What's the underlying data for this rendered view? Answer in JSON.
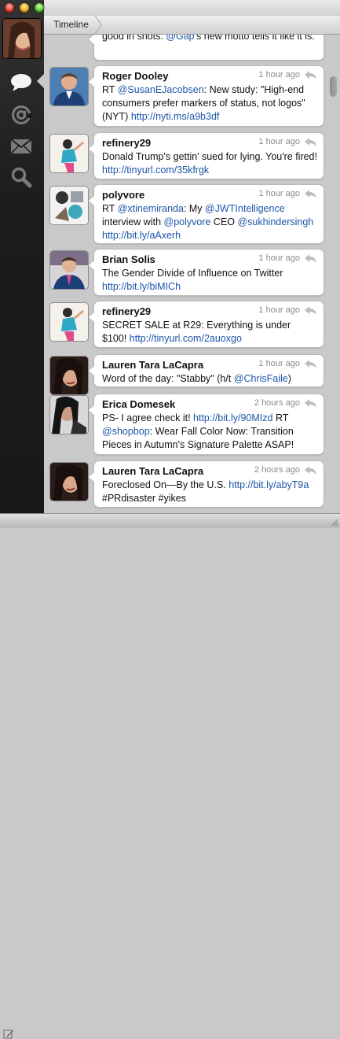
{
  "window": {
    "title": "Timeline"
  },
  "sidebar": {
    "items": [
      {
        "name": "timeline",
        "icon": "speech-bubble-icon"
      },
      {
        "name": "mentions",
        "icon": "at-sign-icon"
      },
      {
        "name": "messages",
        "icon": "envelope-icon"
      },
      {
        "name": "search",
        "icon": "magnifier-icon"
      }
    ]
  },
  "tweets": [
    {
      "name": "",
      "time": "",
      "parts": [
        {
          "t": "good in shots. ",
          "link": false
        },
        {
          "t": "@Gap",
          "link": true
        },
        {
          "t": "'s new motto tells it like it is.",
          "link": false
        }
      ]
    },
    {
      "name": "Roger Dooley",
      "time": "1 hour ago",
      "parts": [
        {
          "t": "RT ",
          "link": false
        },
        {
          "t": "@SusanEJacobsen",
          "link": true
        },
        {
          "t": ": New study:  \"High-end consumers prefer markers of status, not logos\" (NYT) ",
          "link": false
        },
        {
          "t": "http://nyti.ms/a9b3df",
          "link": true
        }
      ]
    },
    {
      "name": "refinery29",
      "time": "1 hour ago",
      "parts": [
        {
          "t": "Donald Trump's gettin' sued for lying. You're fired! ",
          "link": false
        },
        {
          "t": "http://tinyurl.com/35kfrgk",
          "link": true
        }
      ]
    },
    {
      "name": "polyvore",
      "time": "1 hour ago",
      "parts": [
        {
          "t": "RT ",
          "link": false
        },
        {
          "t": "@xtinemiranda",
          "link": true
        },
        {
          "t": ": My ",
          "link": false
        },
        {
          "t": "@JWTIntelligence",
          "link": true
        },
        {
          "t": " interview with ",
          "link": false
        },
        {
          "t": "@polyvore",
          "link": true
        },
        {
          "t": " CEO ",
          "link": false
        },
        {
          "t": "@sukhindersingh",
          "link": true
        },
        {
          "t": " ",
          "link": false
        },
        {
          "t": "http://bit.ly/aAxerh",
          "link": true
        }
      ]
    },
    {
      "name": "Brian Solis",
      "time": "1 hour ago",
      "parts": [
        {
          "t": "The Gender Divide of Influence on Twitter ",
          "link": false
        },
        {
          "t": "http://bit.ly/biMICh",
          "link": true
        }
      ]
    },
    {
      "name": "refinery29",
      "time": "1 hour ago",
      "parts": [
        {
          "t": "SECRET SALE at R29: Everything is under $100! ",
          "link": false
        },
        {
          "t": "http://tinyurl.com/2auoxgo",
          "link": true
        }
      ]
    },
    {
      "name": "Lauren Tara LaCapra",
      "time": "1 hour ago",
      "parts": [
        {
          "t": "Word of the day: \"Stabby\" (h/t ",
          "link": false
        },
        {
          "t": "@ChrisFaile",
          "link": true
        },
        {
          "t": ")",
          "link": false
        }
      ]
    },
    {
      "name": "Erica Domesek",
      "time": "2 hours ago",
      "parts": [
        {
          "t": "PS- I agree check it!  ",
          "link": false
        },
        {
          "t": "http://bit.ly/90MIzd",
          "link": true
        },
        {
          "t": " RT ",
          "link": false
        },
        {
          "t": "@shopbop",
          "link": true
        },
        {
          "t": ": Wear Fall Color Now: Transition Pieces in Autumn's Signature Palette ASAP!",
          "link": false
        }
      ]
    },
    {
      "name": "Lauren Tara LaCapra",
      "time": "2 hours ago",
      "parts": [
        {
          "t": "Foreclosed On—By the U.S. ",
          "link": false
        },
        {
          "t": "http://bit.ly/abyT9a",
          "link": true
        },
        {
          "t": " #PRdisaster #yikes",
          "link": false
        }
      ]
    }
  ],
  "colors": {
    "link": "#1d55a8",
    "sidebar": "#1c1c1c",
    "background": "#c9c9c9"
  }
}
